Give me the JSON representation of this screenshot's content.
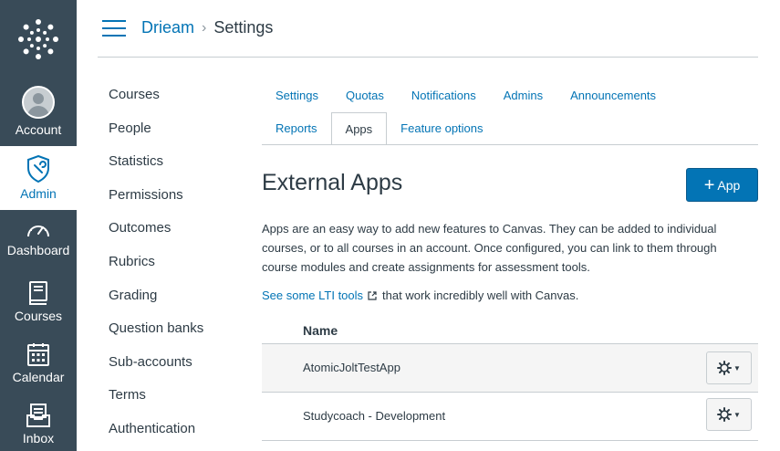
{
  "global_nav": {
    "account": "Account",
    "admin": "Admin",
    "dashboard": "Dashboard",
    "courses": "Courses",
    "calendar": "Calendar",
    "inbox": "Inbox"
  },
  "breadcrumb": {
    "root": "Drieam",
    "current": "Settings"
  },
  "sub_nav": [
    "Courses",
    "People",
    "Statistics",
    "Permissions",
    "Outcomes",
    "Rubrics",
    "Grading",
    "Question banks",
    "Sub-accounts",
    "Terms",
    "Authentication"
  ],
  "tabs": {
    "row1": [
      "Settings",
      "Quotas",
      "Notifications",
      "Admins",
      "Announcements"
    ],
    "row2": [
      "Reports",
      "Apps",
      "Feature options"
    ],
    "active": "Apps"
  },
  "page": {
    "title": "External Apps",
    "add_button": "App",
    "description": "Apps are an easy way to add new features to Canvas. They can be added to individual courses, or to all courses in an account. Once configured, you can link to them through course modules and create assignments for assessment tools.",
    "lti_link": "See some LTI tools",
    "lti_suffix": "that work incredibly well with Canvas."
  },
  "table": {
    "header": "Name",
    "rows": [
      "AtomicJoltTestApp",
      "Studycoach - Development"
    ]
  },
  "colors": {
    "nav_bg": "#394b58",
    "link": "#0374b5",
    "primary_button": "#0374b5",
    "text": "#2d3b45",
    "border": "#c7cdd1"
  }
}
